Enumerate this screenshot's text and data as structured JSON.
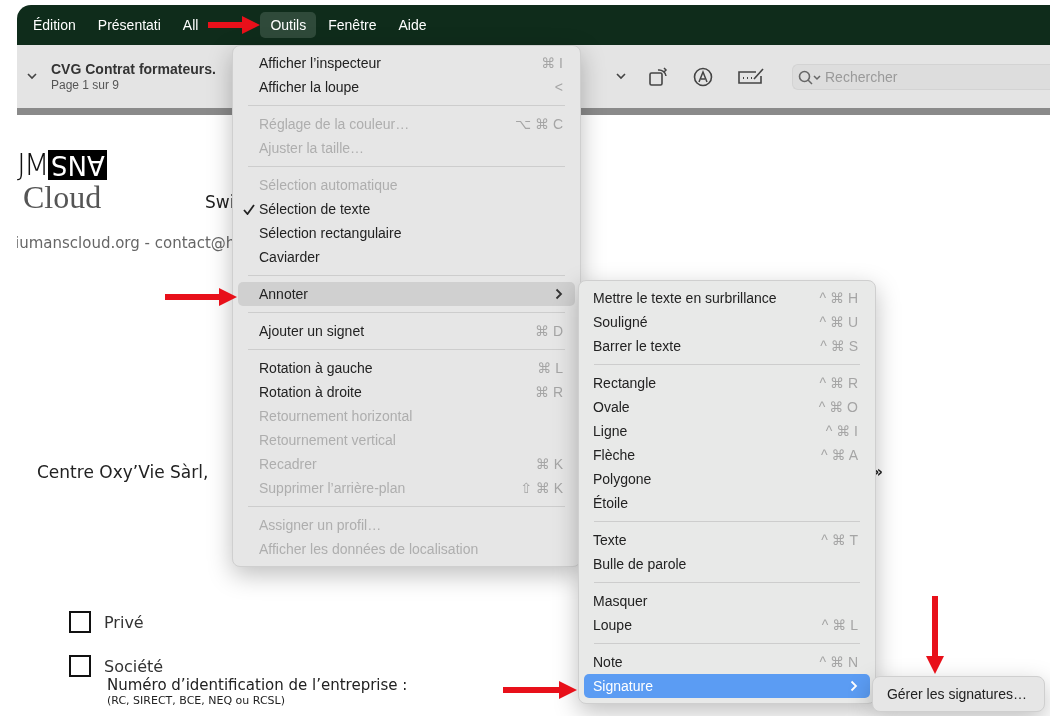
{
  "menubar": [
    {
      "label": "Édition",
      "selected": false
    },
    {
      "label": "Présentati",
      "selected": false
    },
    {
      "label": "All",
      "selected": false
    },
    {
      "label": "Outils",
      "selected": true
    },
    {
      "label": "Fenêtre",
      "selected": false
    },
    {
      "label": "Aide",
      "selected": false
    }
  ],
  "toolbar": {
    "title": "CVG Contrat formateurs.",
    "subtitle": "Page 1 sur 9",
    "search": {
      "placeholder": "Rechercher"
    }
  },
  "document": {
    "logo_text": "JM",
    "logo_inverse": "ANS",
    "logo_sub": "Cloud",
    "fragment": "Swi",
    "contact": "iumanscloud.org - contact@h",
    "company": "Centre Oxy’Vie Sàrl,",
    "quote_mark": "»",
    "options": [
      {
        "label": "Privé",
        "checked": false
      },
      {
        "label": "Société",
        "checked": false
      }
    ],
    "id_label": "Numéro d’identification de l’entreprise :",
    "id_hint": "(RC, SIRECT, BCE, NEQ ou RCSL)"
  },
  "menus": [
    {
      "active": false,
      "items": [
        {
          "kind": "item",
          "label": "Afficher l’inspecteur",
          "shortcut": "⌘ I",
          "disabled": false,
          "checked": false,
          "selected": false,
          "submenu": false
        },
        {
          "kind": "item",
          "label": "Afficher la loupe",
          "shortcut": "<",
          "disabled": false,
          "checked": false,
          "selected": false,
          "submenu": false
        },
        {
          "kind": "separator"
        },
        {
          "kind": "item",
          "label": "Réglage de la couleur…",
          "shortcut": "⌥ ⌘ C",
          "disabled": true,
          "checked": false,
          "selected": false,
          "submenu": false
        },
        {
          "kind": "item",
          "label": "Ajuster la taille…",
          "disabled": true,
          "checked": false,
          "selected": false,
          "submenu": false
        },
        {
          "kind": "separator"
        },
        {
          "kind": "item",
          "label": "Sélection automatique",
          "disabled": true,
          "checked": false,
          "selected": false,
          "submenu": false
        },
        {
          "kind": "item",
          "label": "Sélection de texte",
          "disabled": false,
          "checked": true,
          "selected": false,
          "submenu": false
        },
        {
          "kind": "item",
          "label": "Sélection rectangulaire",
          "disabled": false,
          "checked": false,
          "selected": false,
          "submenu": false
        },
        {
          "kind": "item",
          "label": "Caviarder",
          "disabled": false,
          "checked": false,
          "selected": false,
          "submenu": false
        },
        {
          "kind": "separator"
        },
        {
          "kind": "item",
          "label": "Annoter",
          "disabled": false,
          "checked": false,
          "selected": true,
          "submenu": true
        },
        {
          "kind": "separator"
        },
        {
          "kind": "item",
          "label": "Ajouter un signet",
          "shortcut": "⌘ D",
          "disabled": false,
          "checked": false,
          "selected": false,
          "submenu": false
        },
        {
          "kind": "separator"
        },
        {
          "kind": "item",
          "label": "Rotation à gauche",
          "shortcut": "⌘ L",
          "disabled": false,
          "checked": false,
          "selected": false,
          "submenu": false
        },
        {
          "kind": "item",
          "label": "Rotation à droite",
          "shortcut": "⌘ R",
          "disabled": false,
          "checked": false,
          "selected": false,
          "submenu": false
        },
        {
          "kind": "item",
          "label": "Retournement horizontal",
          "disabled": true,
          "checked": false,
          "selected": false,
          "submenu": false
        },
        {
          "kind": "item",
          "label": "Retournement vertical",
          "disabled": true,
          "checked": false,
          "selected": false,
          "submenu": false
        },
        {
          "kind": "item",
          "label": "Recadrer",
          "shortcut": "⌘ K",
          "disabled": true,
          "checked": false,
          "selected": false,
          "submenu": false
        },
        {
          "kind": "item",
          "label": "Supprimer l’arrière-plan",
          "shortcut": "⇧ ⌘ K",
          "disabled": true,
          "checked": false,
          "selected": false,
          "submenu": false
        },
        {
          "kind": "separator"
        },
        {
          "kind": "item",
          "label": "Assigner un profil…",
          "disabled": true,
          "checked": false,
          "selected": false,
          "submenu": false
        },
        {
          "kind": "item",
          "label": "Afficher les données de localisation",
          "disabled": true,
          "checked": false,
          "selected": false,
          "submenu": false
        }
      ]
    },
    {
      "active": true,
      "items": [
        {
          "kind": "item",
          "label": "Mettre le texte en surbrillance",
          "shortcut": "^ ⌘ H",
          "disabled": false,
          "checked": false,
          "selected": false,
          "submenu": false
        },
        {
          "kind": "item",
          "label": "Souligné",
          "shortcut": "^ ⌘ U",
          "disabled": false,
          "checked": false,
          "selected": false,
          "submenu": false
        },
        {
          "kind": "item",
          "label": "Barrer le texte",
          "shortcut": "^ ⌘ S",
          "disabled": false,
          "checked": false,
          "selected": false,
          "submenu": false
        },
        {
          "kind": "separator"
        },
        {
          "kind": "item",
          "label": "Rectangle",
          "shortcut": "^ ⌘ R",
          "disabled": false,
          "checked": false,
          "selected": false,
          "submenu": false
        },
        {
          "kind": "item",
          "label": "Ovale",
          "shortcut": "^ ⌘ O",
          "disabled": false,
          "checked": false,
          "selected": false,
          "submenu": false
        },
        {
          "kind": "item",
          "label": "Ligne",
          "shortcut": "^ ⌘ I",
          "disabled": false,
          "checked": false,
          "selected": false,
          "submenu": false
        },
        {
          "kind": "item",
          "label": "Flèche",
          "shortcut": "^ ⌘ A",
          "disabled": false,
          "checked": false,
          "selected": false,
          "submenu": false
        },
        {
          "kind": "item",
          "label": "Polygone",
          "disabled": false,
          "checked": false,
          "selected": false,
          "submenu": false
        },
        {
          "kind": "item",
          "label": "Étoile",
          "disabled": false,
          "checked": false,
          "selected": false,
          "submenu": false
        },
        {
          "kind": "separator"
        },
        {
          "kind": "item",
          "label": "Texte",
          "shortcut": "^ ⌘ T",
          "disabled": false,
          "checked": false,
          "selected": false,
          "submenu": false
        },
        {
          "kind": "item",
          "label": "Bulle de parole",
          "disabled": false,
          "checked": false,
          "selected": false,
          "submenu": false
        },
        {
          "kind": "separator"
        },
        {
          "kind": "item",
          "label": "Masquer",
          "disabled": false,
          "checked": false,
          "selected": false,
          "submenu": false
        },
        {
          "kind": "item",
          "label": "Loupe",
          "shortcut": "^ ⌘ L",
          "disabled": false,
          "checked": false,
          "selected": false,
          "submenu": false
        },
        {
          "kind": "separator"
        },
        {
          "kind": "item",
          "label": "Note",
          "shortcut": "^ ⌘ N",
          "disabled": false,
          "checked": false,
          "selected": false,
          "submenu": false
        },
        {
          "kind": "item",
          "label": "Signature",
          "disabled": false,
          "checked": false,
          "selected": true,
          "submenu": true
        }
      ]
    },
    {
      "items": [
        {
          "kind": "item",
          "label": "Gérer les signatures…",
          "disabled": false,
          "checked": false,
          "selected": false,
          "submenu": false
        }
      ]
    }
  ]
}
